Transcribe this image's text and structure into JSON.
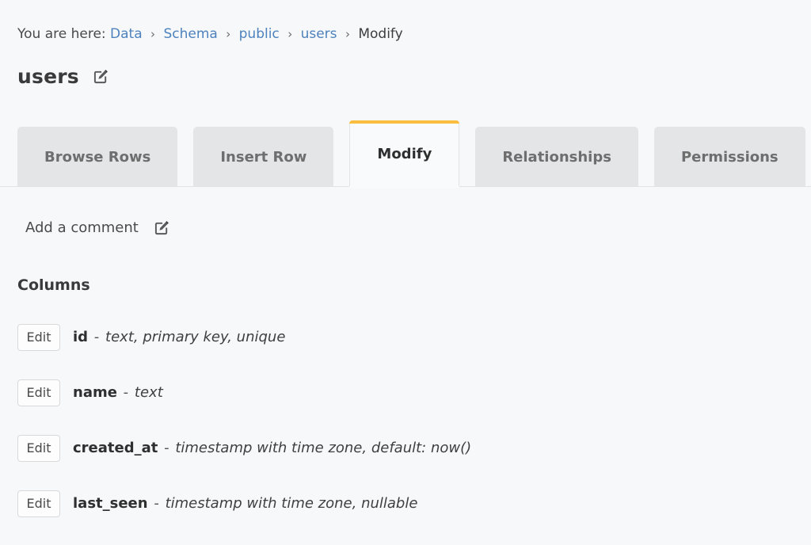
{
  "breadcrumb": {
    "prefix": "You are here:",
    "separator": "›",
    "items": [
      {
        "label": "Data",
        "link": true
      },
      {
        "label": "Schema",
        "link": true
      },
      {
        "label": "public",
        "link": true
      },
      {
        "label": "users",
        "link": true
      },
      {
        "label": "Modify",
        "link": false
      }
    ]
  },
  "header": {
    "title": "users",
    "edit_icon": "pen-to-square-icon"
  },
  "tabs": [
    {
      "label": "Browse Rows",
      "active": false
    },
    {
      "label": "Insert Row",
      "active": false
    },
    {
      "label": "Modify",
      "active": true
    },
    {
      "label": "Relationships",
      "active": false
    },
    {
      "label": "Permissions",
      "active": false
    }
  ],
  "main": {
    "comment": {
      "label": "Add a comment",
      "edit_icon": "pen-to-square-icon"
    },
    "columns_heading": "Columns",
    "edit_label": "Edit",
    "dash": "-",
    "columns": [
      {
        "name": "id",
        "type": "text, primary key, unique"
      },
      {
        "name": "name",
        "type": "text"
      },
      {
        "name": "created_at",
        "type": "timestamp with time zone, default: now()"
      },
      {
        "name": "last_seen",
        "type": "timestamp with time zone, nullable"
      }
    ]
  },
  "colors": {
    "accent": "#fbbd40",
    "link": "#4e82bd",
    "page_bg": "#f7f8fa",
    "tab_bg": "#e4e5e6",
    "tab_active_bg": "#f9fafb"
  }
}
